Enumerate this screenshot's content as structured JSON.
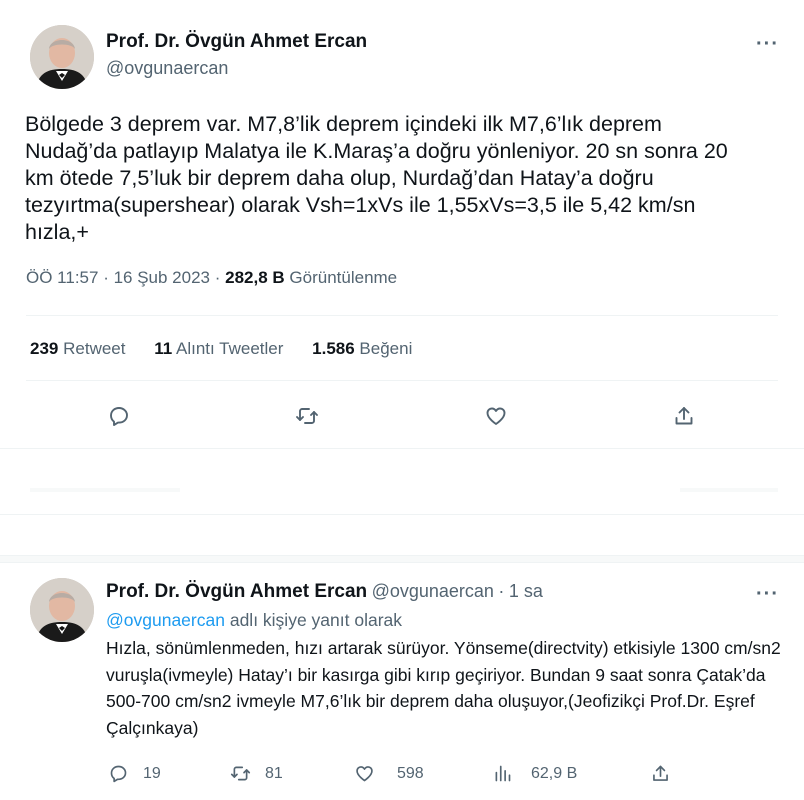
{
  "main_tweet": {
    "author_name": "Prof. Dr. Övgün Ahmet Ercan",
    "author_handle": "@ovgunaercan",
    "text": "Bölgede 3 deprem var. M7,8’lik deprem içindeki ilk M7,6’lık deprem Nudağ’da patlayıp Malatya ile K.Maraş’a doğru yönleniyor. 20 sn sonra 20 km ötede 7,5’luk bir deprem daha olup, Nurdağ’dan Hatay’a doğru tezyırtma(supershear) olarak Vsh=1xVs ile 1,55xVs=3,5 ile 5,42 km/sn hızla,+",
    "time": "ÖÖ 11:57",
    "date": "16 Şub 2023",
    "views_count": "282,8 B",
    "views_label": "Görüntülenme",
    "retweets_count": "239",
    "retweets_label": "Retweet",
    "quotes_count": "11",
    "quotes_label": "Alıntı Tweetler",
    "likes_count": "1.586",
    "likes_label": "Beğeni"
  },
  "reply_tweet": {
    "author_name": "Prof. Dr. Övgün Ahmet Ercan",
    "author_handle": "@ovgunaercan",
    "time_ago": "1 sa",
    "reply_to_mention": "@ovgunaercan",
    "reply_to_suffix": "adlı kişiye yanıt olarak",
    "text": "Hızla, sönümlenmeden, hızı artarak sürüyor. Yönseme(directvity) etkisiyle 1300 cm/sn2 vuruşla(ivmeyle) Hatay’ı bir kasırga gibi kırıp geçiriyor. Bundan 9 saat sonra Çatak’da 500-700 cm/sn2 ivmeyle M7,6’lık bir deprem daha oluşuyor,(Jeofizikçi Prof.Dr. Eşref Çalçınkaya)",
    "replies": "19",
    "retweets": "81",
    "likes": "598",
    "views": "62,9 B"
  },
  "icons": {
    "more": "more-horizontal-icon",
    "reply": "comment-bubble-icon",
    "retweet": "retweet-arrows-icon",
    "like": "heart-icon",
    "share": "share-upload-icon",
    "views": "bar-chart-icon"
  },
  "colors": {
    "link": "#1d9bf0",
    "secondary_text": "#536471",
    "primary_text": "#0f1419",
    "divider": "#eff3f4"
  }
}
